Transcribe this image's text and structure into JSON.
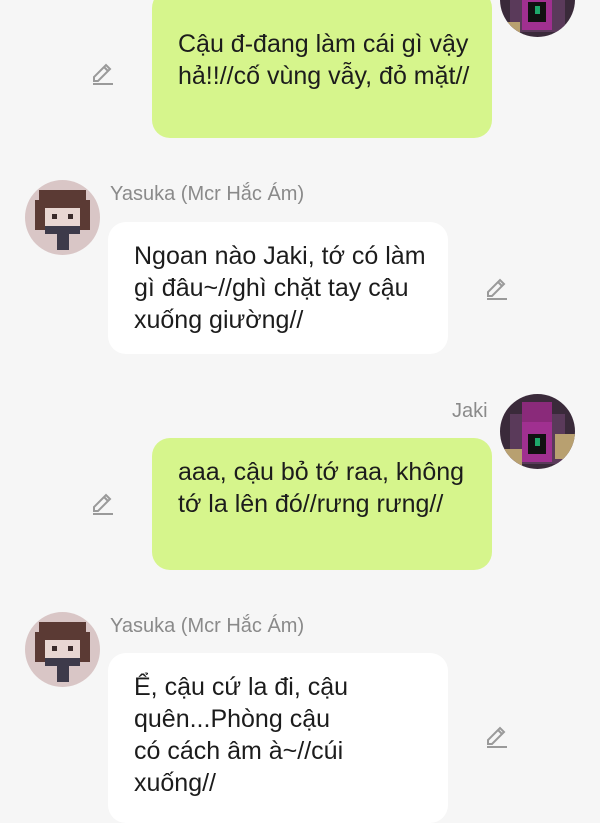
{
  "messages": [
    {
      "id": "m1",
      "direction": "outgoing",
      "sender": "",
      "text": "Cậu đ-đang làm cái gì vậy hả!!//cố vùng vẫy, đỏ mặt//"
    },
    {
      "id": "m2",
      "direction": "incoming",
      "sender": "Yasuka (Mcr Hắc Ám)",
      "text": "Ngoan nào Jaki, tớ có làm gì đâu~//ghì chặt tay cậu xuống giường//"
    },
    {
      "id": "m3",
      "direction": "outgoing",
      "sender": "Jaki",
      "text": "aaa, cậu bỏ tớ raa, không tớ la lên đó//rưng rưng//"
    },
    {
      "id": "m4",
      "direction": "incoming",
      "sender": "Yasuka (Mcr Hắc Ám)",
      "text": "Ể, cậu cứ la đi, cậu quên...Phòng cậu có cách âm à~//cúi xuống//"
    }
  ],
  "icons": {
    "edit": "pencil-edit-icon"
  },
  "colors": {
    "background": "#f6f6f6",
    "outgoing_bubble": "#d6f58c",
    "incoming_bubble": "#ffffff",
    "sender_name": "#8a8a8a",
    "icon": "#9a9a9a"
  }
}
